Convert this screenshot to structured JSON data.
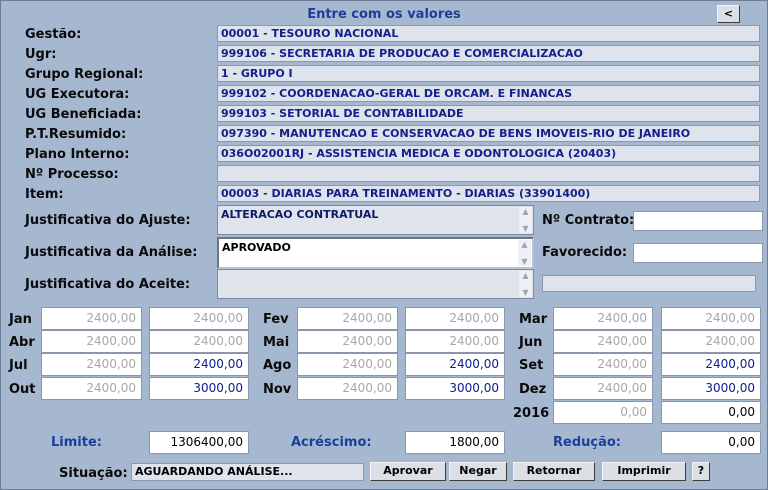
{
  "title": "Entre com os valores",
  "back_label": "<",
  "fields": [
    {
      "label": "Gestão:",
      "value": "00001 - TESOURO NACIONAL"
    },
    {
      "label": "Ugr:",
      "value": "999106 - SECRETARIA DE PRODUCAO E COMERCIALIZACAO"
    },
    {
      "label": "Grupo Regional:",
      "value": "1 - GRUPO I"
    },
    {
      "label": "UG Executora:",
      "value": "999102 - COORDENACAO-GERAL DE ORCAM. E FINANCAS"
    },
    {
      "label": "UG Beneficiada:",
      "value": "999103 - SETORIAL DE CONTABILIDADE"
    },
    {
      "label": "P.T.Resumido:",
      "value": "097390 - MANUTENCAO E CONSERVACAO DE BENS IMOVEIS-RIO DE JANEIRO"
    },
    {
      "label": "Plano Interno:",
      "value": "036O02001RJ - ASSISTENCIA MEDICA E ODONTOLOGICA (20403)"
    },
    {
      "label": "Nº Processo:",
      "value": ""
    },
    {
      "label": "Item:",
      "value": "00003 - DIARIAS PARA TREINAMENTO - DIARIAS (33901400)"
    }
  ],
  "justificativas": [
    {
      "label": "Justificativa do Ajuste:",
      "value": "ALTERACAO CONTRATUAL"
    },
    {
      "label": "Justificativa da Análise:",
      "value": "APROVADO"
    },
    {
      "label": "Justificativa do Aceite:",
      "value": ""
    }
  ],
  "contrato": {
    "label": "Nº Contrato:",
    "value": ""
  },
  "favorecido": {
    "label": "Favorecido:",
    "value": ""
  },
  "months": [
    {
      "label": "Jan",
      "a": "2400,00",
      "b": "2400,00"
    },
    {
      "label": "Fev",
      "a": "2400,00",
      "b": "2400,00"
    },
    {
      "label": "Mar",
      "a": "2400,00",
      "b": "2400,00"
    },
    {
      "label": "Abr",
      "a": "2400,00",
      "b": "2400,00"
    },
    {
      "label": "Mai",
      "a": "2400,00",
      "b": "2400,00"
    },
    {
      "label": "Jun",
      "a": "2400,00",
      "b": "2400,00"
    },
    {
      "label": "Jul",
      "a": "2400,00",
      "b": "2400,00"
    },
    {
      "label": "Ago",
      "a": "2400,00",
      "b": "2400,00"
    },
    {
      "label": "Set",
      "a": "2400,00",
      "b": "2400,00"
    },
    {
      "label": "Out",
      "a": "2400,00",
      "b": "3000,00"
    },
    {
      "label": "Nov",
      "a": "2400,00",
      "b": "3000,00"
    },
    {
      "label": "Dez",
      "a": "2400,00",
      "b": "3000,00"
    }
  ],
  "year": {
    "label": "2016",
    "a": "0,00",
    "b": "0,00"
  },
  "limite": {
    "label": "Limite:",
    "value": "1306400,00"
  },
  "acrescimo": {
    "label": "Acréscimo:",
    "value": "1800,00"
  },
  "reducao": {
    "label": "Redução:",
    "value": "0,00"
  },
  "situacao": {
    "label": "Situação:",
    "value": "AGUARDANDO ANÁLISE..."
  },
  "buttons": {
    "aprovar": "Aprovar",
    "negar": "Negar",
    "retornar": "Retornar",
    "imprimir": "Imprimir",
    "help": "?"
  },
  "colors": {
    "background": "#a6b8cf",
    "title": "#1c3e9c",
    "value_text": "#12208d",
    "field_bg": "#dfe3ec"
  }
}
